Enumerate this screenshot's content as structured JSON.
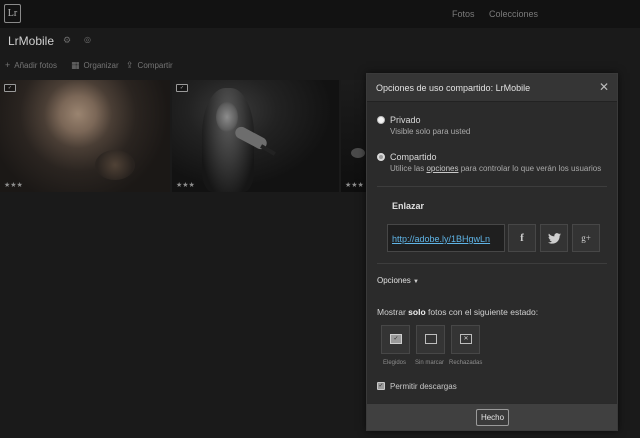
{
  "app": {
    "logo": "Lr"
  },
  "topnav": {
    "fotos": "Fotos",
    "colecciones": "Colecciones"
  },
  "album": {
    "title": "LrMobile"
  },
  "toolbar": {
    "add": "Añadir fotos",
    "organize": "Organizar",
    "share": "Compartir"
  },
  "photos": [
    {
      "rating": "★★★",
      "flag": "pick"
    },
    {
      "rating": "★★★",
      "flag": "pick"
    },
    {
      "rating": "★★★",
      "flag": "none"
    }
  ],
  "modal": {
    "title": "Opciones de uso compartido: LrMobile",
    "privado": {
      "title": "Privado",
      "desc": "Visible solo para usted",
      "selected": false
    },
    "compartido": {
      "title": "Compartido",
      "desc_before": "Utilice las ",
      "desc_link": "opciones",
      "desc_after": " para controlar lo que verán los usuarios",
      "selected": true
    },
    "enlazar": "Enlazar",
    "url": "http://adobe.ly/1BHgwLn",
    "social": {
      "facebook": "f",
      "twitter": "t",
      "googleplus": "g+"
    },
    "opciones": "Opciones",
    "mostrar_before": "Mostrar ",
    "mostrar_bold": "solo",
    "mostrar_after": " fotos con el siguiente estado:",
    "flags": [
      {
        "label": "Elegidos",
        "active": true
      },
      {
        "label": "Sin marcar",
        "active": false
      },
      {
        "label": "Rechazadas",
        "active": false
      }
    ],
    "permitir_descargas": {
      "label": "Permitir descargas",
      "checked": true
    },
    "done": "Hecho"
  },
  "colors": {
    "link": "#5fb4e6",
    "background": "#1a1a1a",
    "panel": "#2b2b2b"
  }
}
